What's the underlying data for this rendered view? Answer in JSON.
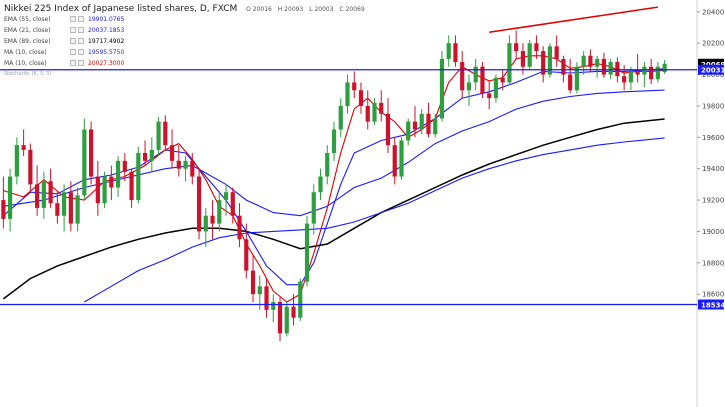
{
  "title": "Nikkei 225 Index of Japanese listed shares, D, FXCM",
  "ohlc": {
    "open": "O 20016",
    "high": "H 20093",
    "low": "L 20003",
    "close": "C 20069"
  },
  "indicators": [
    {
      "name": "EMA (55, close)",
      "value": "19901.0765",
      "color": "#1a1aff"
    },
    {
      "name": "EMA (21, close)",
      "value": "20037.1853",
      "color": "#1a1aff"
    },
    {
      "name": "EMA (89, close)",
      "value": "19717.4902",
      "color": "#000000"
    },
    {
      "name": "MA (10, close)",
      "value": "19595.5750",
      "color": "#1a1aff"
    },
    {
      "name": "MA (10, close)",
      "value": "20027.3000",
      "color": "#e00000"
    }
  ],
  "oscillator_label": "Stochastic (8, 3, 3)",
  "price_tags": {
    "last": "20069",
    "line": "20031",
    "support": "18534"
  },
  "colors": {
    "up": "#2e9e3e",
    "down": "#d0112b",
    "ema_blue": "#1a1aff",
    "ema_black": "#000000",
    "ma_red": "#e00000",
    "hline": "#1a1aff",
    "trend_red": "#e00000",
    "last_tag_bg": "#000000"
  },
  "chart_data": {
    "type": "candlestick",
    "y_axis": {
      "min": 18550,
      "max": 20450,
      "ticks": [
        18600,
        18800,
        19000,
        19200,
        19400,
        19600,
        19800,
        20000,
        20200,
        20400
      ],
      "position": "right"
    },
    "candles_ohlc": [
      [
        19200,
        19350,
        19020,
        19080
      ],
      [
        19080,
        19400,
        19000,
        19350
      ],
      [
        19350,
        19600,
        19300,
        19550
      ],
      [
        19550,
        19650,
        19480,
        19520
      ],
      [
        19520,
        19560,
        19250,
        19300
      ],
      [
        19300,
        19420,
        19100,
        19150
      ],
      [
        19150,
        19380,
        19080,
        19320
      ],
      [
        19320,
        19400,
        19150,
        19180
      ],
      [
        19180,
        19250,
        19050,
        19100
      ],
      [
        19100,
        19300,
        19000,
        19250
      ],
      [
        19250,
        19320,
        19000,
        19050
      ],
      [
        19050,
        19280,
        19000,
        19230
      ],
      [
        19230,
        19720,
        19200,
        19650
      ],
      [
        19650,
        19700,
        19300,
        19350
      ],
      [
        19350,
        19450,
        19100,
        19180
      ],
      [
        19180,
        19380,
        19150,
        19350
      ],
      [
        19350,
        19420,
        19200,
        19280
      ],
      [
        19280,
        19480,
        19220,
        19450
      ],
      [
        19450,
        19500,
        19320,
        19380
      ],
      [
        19380,
        19400,
        19150,
        19200
      ],
      [
        19200,
        19540,
        19180,
        19500
      ],
      [
        19500,
        19580,
        19420,
        19450
      ],
      [
        19450,
        19600,
        19380,
        19520
      ],
      [
        19520,
        19730,
        19480,
        19700
      ],
      [
        19700,
        19740,
        19520,
        19550
      ],
      [
        19550,
        19650,
        19400,
        19450
      ],
      [
        19450,
        19550,
        19350,
        19400
      ],
      [
        19400,
        19480,
        19320,
        19450
      ],
      [
        19450,
        19500,
        19300,
        19350
      ],
      [
        19350,
        19400,
        18950,
        19000
      ],
      [
        19000,
        19150,
        18900,
        19100
      ],
      [
        19100,
        19200,
        18950,
        19050
      ],
      [
        19050,
        19250,
        19000,
        19200
      ],
      [
        19200,
        19300,
        19100,
        19250
      ],
      [
        19250,
        19280,
        19050,
        19100
      ],
      [
        19100,
        19180,
        18900,
        18950
      ],
      [
        18950,
        19050,
        18700,
        18750
      ],
      [
        18750,
        18850,
        18550,
        18600
      ],
      [
        18600,
        18720,
        18500,
        18650
      ],
      [
        18650,
        18700,
        18450,
        18500
      ],
      [
        18500,
        18600,
        18420,
        18550
      ],
      [
        18550,
        18580,
        18300,
        18350
      ],
      [
        18350,
        18550,
        18330,
        18520
      ],
      [
        18520,
        18600,
        18400,
        18450
      ],
      [
        18450,
        18700,
        18430,
        18680
      ],
      [
        18680,
        19100,
        18650,
        19050
      ],
      [
        19050,
        19300,
        18980,
        19250
      ],
      [
        19250,
        19400,
        19200,
        19350
      ],
      [
        19350,
        19550,
        19300,
        19500
      ],
      [
        19500,
        19700,
        19450,
        19650
      ],
      [
        19650,
        19850,
        19600,
        19800
      ],
      [
        19800,
        20000,
        19750,
        19950
      ],
      [
        19950,
        20020,
        19850,
        19900
      ],
      [
        19900,
        19950,
        19750,
        19800
      ],
      [
        19800,
        19900,
        19650,
        19700
      ],
      [
        19700,
        19850,
        19680,
        19820
      ],
      [
        19820,
        19900,
        19700,
        19750
      ],
      [
        19750,
        19850,
        19500,
        19550
      ],
      [
        19550,
        19600,
        19300,
        19350
      ],
      [
        19350,
        19600,
        19330,
        19580
      ],
      [
        19580,
        19720,
        19550,
        19700
      ],
      [
        19700,
        19800,
        19600,
        19650
      ],
      [
        19650,
        19780,
        19620,
        19750
      ],
      [
        19750,
        19820,
        19600,
        19620
      ],
      [
        19620,
        19750,
        19600,
        19720
      ],
      [
        19720,
        20150,
        19700,
        20100
      ],
      [
        20100,
        20250,
        20050,
        20200
      ],
      [
        20200,
        20250,
        20050,
        20080
      ],
      [
        20080,
        20150,
        19850,
        19900
      ],
      [
        19900,
        20000,
        19800,
        19950
      ],
      [
        19950,
        20100,
        19900,
        20050
      ],
      [
        20050,
        20080,
        19850,
        19880
      ],
      [
        19880,
        19960,
        19780,
        19850
      ],
      [
        19850,
        20000,
        19820,
        19980
      ],
      [
        19980,
        20030,
        19900,
        19950
      ],
      [
        19950,
        20250,
        19930,
        20200
      ],
      [
        20200,
        20280,
        20100,
        20150
      ],
      [
        20150,
        20200,
        20000,
        20050
      ],
      [
        20050,
        20220,
        20030,
        20200
      ],
      [
        20200,
        20250,
        20100,
        20150
      ],
      [
        20150,
        20180,
        19950,
        20000
      ],
      [
        20000,
        20200,
        19980,
        20180
      ],
      [
        20180,
        20250,
        20050,
        20100
      ],
      [
        20100,
        20120,
        19950,
        20000
      ],
      [
        20000,
        20100,
        19880,
        19900
      ],
      [
        19900,
        20080,
        19880,
        20050
      ],
      [
        20050,
        20150,
        20000,
        20120
      ],
      [
        20120,
        20160,
        20020,
        20050
      ],
      [
        20050,
        20120,
        19980,
        20100
      ],
      [
        20100,
        20140,
        19980,
        20000
      ],
      [
        20000,
        20100,
        19970,
        20080
      ],
      [
        20080,
        20110,
        19950,
        19990
      ],
      [
        19990,
        20060,
        19900,
        19950
      ],
      [
        19950,
        20050,
        19900,
        20020
      ],
      [
        20020,
        20130,
        19950,
        20000
      ],
      [
        20000,
        20080,
        19920,
        20050
      ],
      [
        20050,
        20100,
        19940,
        19970
      ],
      [
        19970,
        20080,
        19950,
        20050
      ],
      [
        20016,
        20093,
        20003,
        20069
      ]
    ],
    "series": [
      {
        "name": "EMA (55, close)",
        "color": "#1a1aff",
        "points": [
          [
            0,
            19160
          ],
          [
            6,
            19200
          ],
          [
            12,
            19280
          ],
          [
            18,
            19340
          ],
          [
            24,
            19400
          ],
          [
            28,
            19420
          ],
          [
            33,
            19300
          ],
          [
            36,
            19200
          ],
          [
            40,
            19120
          ],
          [
            44,
            19100
          ],
          [
            48,
            19160
          ],
          [
            52,
            19280
          ],
          [
            56,
            19340
          ],
          [
            60,
            19440
          ],
          [
            64,
            19560
          ],
          [
            68,
            19640
          ],
          [
            72,
            19700
          ],
          [
            76,
            19780
          ],
          [
            80,
            19830
          ],
          [
            84,
            19860
          ],
          [
            88,
            19880
          ],
          [
            92,
            19890
          ],
          [
            98,
            19901
          ]
        ]
      },
      {
        "name": "EMA (21, close)",
        "color": "#1a1aff",
        "points": [
          [
            0,
            19100
          ],
          [
            4,
            19250
          ],
          [
            8,
            19240
          ],
          [
            12,
            19330
          ],
          [
            16,
            19360
          ],
          [
            20,
            19410
          ],
          [
            24,
            19520
          ],
          [
            27,
            19500
          ],
          [
            30,
            19350
          ],
          [
            33,
            19200
          ],
          [
            36,
            19000
          ],
          [
            39,
            18780
          ],
          [
            42,
            18660
          ],
          [
            44,
            18660
          ],
          [
            46,
            18800
          ],
          [
            48,
            19050
          ],
          [
            50,
            19300
          ],
          [
            52,
            19500
          ],
          [
            56,
            19580
          ],
          [
            60,
            19620
          ],
          [
            64,
            19720
          ],
          [
            68,
            19850
          ],
          [
            72,
            19890
          ],
          [
            76,
            19950
          ],
          [
            80,
            20020
          ],
          [
            84,
            20010
          ],
          [
            88,
            20020
          ],
          [
            92,
            20020
          ],
          [
            98,
            20037
          ]
        ]
      },
      {
        "name": "EMA (89, close)",
        "color": "#000000",
        "points": [
          [
            0,
            18570
          ],
          [
            4,
            18700
          ],
          [
            8,
            18780
          ],
          [
            12,
            18840
          ],
          [
            16,
            18900
          ],
          [
            20,
            18950
          ],
          [
            24,
            18990
          ],
          [
            28,
            19020
          ],
          [
            32,
            19020
          ],
          [
            36,
            19000
          ],
          [
            40,
            18950
          ],
          [
            44,
            18890
          ],
          [
            48,
            18920
          ],
          [
            52,
            19020
          ],
          [
            56,
            19120
          ],
          [
            60,
            19200
          ],
          [
            64,
            19280
          ],
          [
            68,
            19360
          ],
          [
            72,
            19430
          ],
          [
            76,
            19490
          ],
          [
            80,
            19550
          ],
          [
            84,
            19600
          ],
          [
            88,
            19650
          ],
          [
            92,
            19690
          ],
          [
            98,
            19717
          ]
        ]
      },
      {
        "name": "MA (10, close) blue",
        "color": "#1a1aff",
        "points": [
          [
            12,
            18550
          ],
          [
            16,
            18650
          ],
          [
            20,
            18750
          ],
          [
            24,
            18820
          ],
          [
            28,
            18900
          ],
          [
            32,
            18960
          ],
          [
            36,
            18990
          ],
          [
            40,
            19000
          ],
          [
            44,
            19010
          ],
          [
            48,
            19020
          ],
          [
            52,
            19060
          ],
          [
            56,
            19120
          ],
          [
            60,
            19180
          ],
          [
            64,
            19260
          ],
          [
            68,
            19340
          ],
          [
            72,
            19400
          ],
          [
            76,
            19450
          ],
          [
            80,
            19490
          ],
          [
            84,
            19520
          ],
          [
            88,
            19550
          ],
          [
            92,
            19570
          ],
          [
            98,
            19596
          ]
        ]
      },
      {
        "name": "MA (10, close) red",
        "color": "#e00000",
        "points": [
          [
            0,
            19260
          ],
          [
            3,
            19220
          ],
          [
            6,
            19330
          ],
          [
            9,
            19220
          ],
          [
            12,
            19200
          ],
          [
            15,
            19320
          ],
          [
            18,
            19350
          ],
          [
            21,
            19420
          ],
          [
            24,
            19520
          ],
          [
            26,
            19560
          ],
          [
            28,
            19460
          ],
          [
            30,
            19330
          ],
          [
            32,
            19160
          ],
          [
            34,
            19100
          ],
          [
            36,
            18920
          ],
          [
            38,
            18780
          ],
          [
            40,
            18620
          ],
          [
            42,
            18550
          ],
          [
            44,
            18600
          ],
          [
            46,
            18860
          ],
          [
            48,
            19150
          ],
          [
            50,
            19500
          ],
          [
            52,
            19780
          ],
          [
            54,
            19850
          ],
          [
            56,
            19760
          ],
          [
            58,
            19700
          ],
          [
            60,
            19600
          ],
          [
            62,
            19650
          ],
          [
            64,
            19720
          ],
          [
            66,
            19950
          ],
          [
            68,
            20050
          ],
          [
            70,
            20000
          ],
          [
            72,
            19960
          ],
          [
            74,
            19980
          ],
          [
            76,
            20100
          ],
          [
            78,
            20120
          ],
          [
            80,
            20120
          ],
          [
            82,
            20100
          ],
          [
            84,
            20040
          ],
          [
            86,
            20050
          ],
          [
            88,
            20070
          ],
          [
            90,
            20050
          ],
          [
            92,
            20010
          ],
          [
            94,
            20020
          ],
          [
            96,
            20020
          ],
          [
            98,
            20027
          ]
        ]
      }
    ],
    "trendline": {
      "color": "#e00000",
      "from": [
        72,
        20270
      ],
      "to": [
        97,
        20430
      ]
    },
    "h_lines": [
      {
        "value": 20031,
        "color": "#1a1aff"
      },
      {
        "value": 18534,
        "color": "#1a1aff"
      }
    ]
  }
}
